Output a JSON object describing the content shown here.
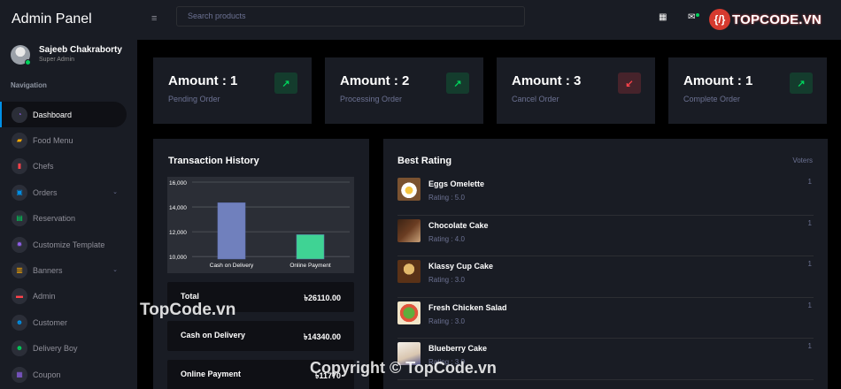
{
  "app": {
    "brand": "Admin Panel"
  },
  "profile": {
    "name": "Sajeeb Chakraborty",
    "role": "Super Admin"
  },
  "sidebar": {
    "heading": "Navigation",
    "items": [
      {
        "label": "Dashboard",
        "icon": "speedometer-icon",
        "glyph": "◔",
        "color": "#8f5fe8"
      },
      {
        "label": "Food Menu",
        "icon": "food-icon",
        "glyph": "▰",
        "color": "#ffab00"
      },
      {
        "label": "Chefs",
        "icon": "chart-icon",
        "glyph": "▮",
        "color": "#fc424a"
      },
      {
        "label": "Orders",
        "icon": "orders-icon",
        "glyph": "▣",
        "color": "#0090e7"
      },
      {
        "label": "Reservation",
        "icon": "table-icon",
        "glyph": "▤",
        "color": "#00d25b"
      },
      {
        "label": "Customize Template",
        "icon": "settings-icon",
        "glyph": "✹",
        "color": "#8f5fe8"
      },
      {
        "label": "Banners",
        "icon": "banner-icon",
        "glyph": "▥",
        "color": "#ffab00"
      },
      {
        "label": "Admin",
        "icon": "admin-icon",
        "glyph": "▬",
        "color": "#fc424a"
      },
      {
        "label": "Customer",
        "icon": "customer-icon",
        "glyph": "☻",
        "color": "#0090e7"
      },
      {
        "label": "Delivery Boy",
        "icon": "delivery-icon",
        "glyph": "☻",
        "color": "#00d25b"
      },
      {
        "label": "Coupon",
        "icon": "coupon-icon",
        "glyph": "▦",
        "color": "#8f5fe8"
      }
    ]
  },
  "topbar": {
    "search_placeholder": "Search products",
    "logo_mark": "{/}",
    "logo_text": "TOPCODE.VN"
  },
  "stats": [
    {
      "amount": "Amount : 1",
      "label": "Pending Order",
      "direction": "up"
    },
    {
      "amount": "Amount : 2",
      "label": "Processing Order",
      "direction": "up"
    },
    {
      "amount": "Amount : 3",
      "label": "Cancel Order",
      "direction": "down"
    },
    {
      "amount": "Amount : 1",
      "label": "Complete Order",
      "direction": "up"
    }
  ],
  "transactions": {
    "title": "Transaction History",
    "chart_data": {
      "type": "bar",
      "categories": [
        "Cash on Delivery",
        "Online Payment"
      ],
      "values": [
        14340,
        11770
      ],
      "ylim": [
        9800,
        16000
      ],
      "yticks": [
        "10,000",
        "12,000",
        "14,000",
        "16,000"
      ],
      "colors": [
        "#7080bd",
        "#3fd394"
      ]
    },
    "rows": [
      {
        "label": "Total",
        "value": "৳26110.00"
      },
      {
        "label": "Cash on Delivery",
        "value": "৳14340.00"
      },
      {
        "label": "Online Payment",
        "value": "৳11770"
      }
    ]
  },
  "rating": {
    "title": "Best Rating",
    "voters_label": "Voters",
    "items": [
      {
        "name": "Eggs Omelette",
        "rating": "Rating : 5.0",
        "votes": "1"
      },
      {
        "name": "Chocolate Cake",
        "rating": "Rating : 4.0",
        "votes": "1"
      },
      {
        "name": "Klassy Cup Cake",
        "rating": "Rating : 3.0",
        "votes": "1"
      },
      {
        "name": "Fresh Chicken Salad",
        "rating": "Rating : 3.0",
        "votes": "1"
      },
      {
        "name": "Blueberry Cake",
        "rating": "Rating : 3.0",
        "votes": "1"
      }
    ]
  },
  "watermarks": {
    "primary": "TopCode.vn",
    "secondary": "Copyright © TopCode.vn"
  }
}
